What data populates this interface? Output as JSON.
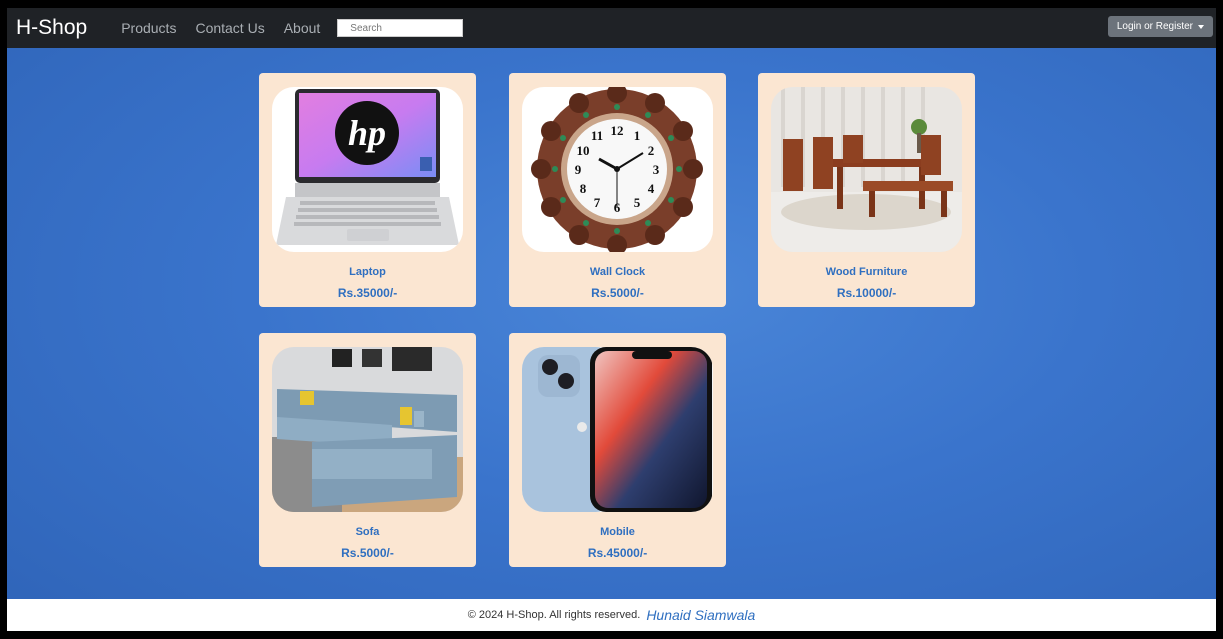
{
  "navbar": {
    "brand": "H-Shop",
    "links": [
      "Products",
      "Contact Us",
      "About"
    ],
    "search_placeholder": "Search",
    "login_label": "Login or Register"
  },
  "products": [
    {
      "name": "Laptop",
      "price": "Rs.35000/-",
      "icon": "laptop-image"
    },
    {
      "name": "Wall Clock",
      "price": "Rs.5000/-",
      "icon": "wall-clock-image"
    },
    {
      "name": "Wood Furniture",
      "price": "Rs.10000/-",
      "icon": "wood-furniture-image"
    },
    {
      "name": "Sofa",
      "price": "Rs.5000/-",
      "icon": "sofa-image"
    },
    {
      "name": "Mobile",
      "price": "Rs.45000/-",
      "icon": "mobile-image"
    }
  ],
  "footer": {
    "copyright": "© 2024 H-Shop. All rights reserved.",
    "author": "Hunaid Siamwala"
  },
  "colors": {
    "navbar_bg": "#1f2226",
    "card_bg": "#fbe6d2",
    "accent_text": "#2f6fc0",
    "page_bg": "#3a74cc"
  }
}
